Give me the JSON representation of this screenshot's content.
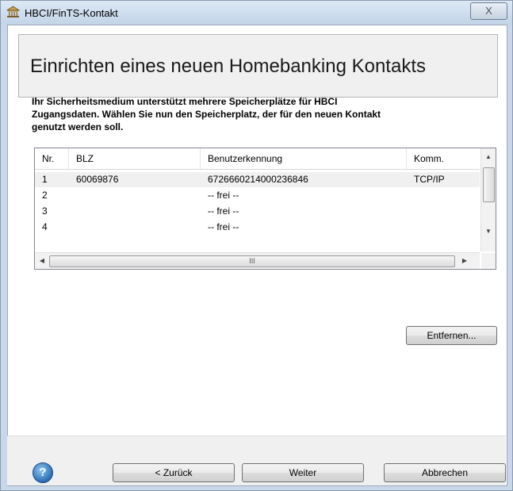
{
  "window": {
    "title": "HBCI/FinTS-Kontakt",
    "close_glyph": "X"
  },
  "header": {
    "title": "Einrichten eines neuen Homebanking Kontakts"
  },
  "intro": {
    "text": "Ihr Sicherheitsmedium unterstützt mehrere Speicherplätze für HBCI Zugangsdaten. Wählen Sie nun den Speicherplatz, der für den neuen Kontakt genutzt werden soll."
  },
  "slots_table": {
    "columns": [
      "Nr.",
      "BLZ",
      "Benutzerkennung",
      "Komm."
    ],
    "rows": [
      {
        "nr": "1",
        "blz": "60069876",
        "user": "6726660214000236846",
        "comm": "TCP/IP"
      },
      {
        "nr": "2",
        "blz": "",
        "user": "-- frei --",
        "comm": ""
      },
      {
        "nr": "3",
        "blz": "",
        "user": "-- frei --",
        "comm": ""
      },
      {
        "nr": "4",
        "blz": "",
        "user": "-- frei --",
        "comm": ""
      }
    ],
    "hscroll_grip": "III"
  },
  "buttons": {
    "remove": "Entfernen...",
    "back": "< Zurück",
    "next": "Weiter",
    "cancel": "Abbrechen"
  },
  "icons": {
    "app": "bank-building-icon",
    "help": "help-icon",
    "help_glyph": "?"
  }
}
